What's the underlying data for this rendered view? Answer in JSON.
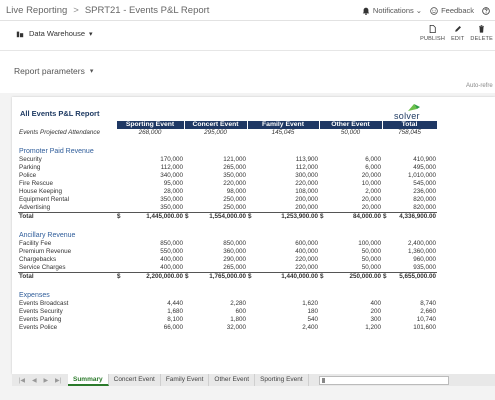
{
  "breadcrumb": {
    "root": "Live Reporting",
    "sep": ">",
    "current": "SPRT21 - Events P&L Report"
  },
  "topbar": {
    "notifications": "Notifications",
    "notif_chev": "⌄",
    "feedback": "Feedback"
  },
  "toolbar": {
    "data_source": "Data Warehouse",
    "chev": "▾",
    "actions": [
      {
        "label": "PUBLISH",
        "icon": "document-icon"
      },
      {
        "label": "EDIT",
        "icon": "pencil-icon"
      },
      {
        "label": "DELETE",
        "icon": "trash-icon"
      }
    ]
  },
  "params": {
    "label": "Report parameters",
    "chev": "▾",
    "auto_refresh": "Auto-refre"
  },
  "report": {
    "title": "All Events P&L Report",
    "logo_text": "solver",
    "columns": [
      "Sporting Event",
      "Concert Event",
      "Family Event",
      "Other Event",
      "Total"
    ],
    "attendance": {
      "label": "Events Projected Attendance",
      "values": [
        "268,000",
        "295,000",
        "145,045",
        "50,000",
        "758,045"
      ]
    },
    "sections": [
      {
        "title": "Promoter Paid Revenue",
        "rows": [
          {
            "label": "Security",
            "values": [
              "170,000",
              "121,000",
              "113,900",
              "6,000",
              "410,900"
            ]
          },
          {
            "label": "Parking",
            "values": [
              "112,000",
              "265,000",
              "112,000",
              "6,000",
              "495,000"
            ]
          },
          {
            "label": "Police",
            "values": [
              "340,000",
              "350,000",
              "300,000",
              "20,000",
              "1,010,000"
            ]
          },
          {
            "label": "Fire Rescue",
            "values": [
              "95,000",
              "220,000",
              "220,000",
              "10,000",
              "545,000"
            ]
          },
          {
            "label": "House Keeping",
            "values": [
              "28,000",
              "98,000",
              "108,000",
              "2,000",
              "236,000"
            ]
          },
          {
            "label": "Equipment Rental",
            "values": [
              "350,000",
              "250,000",
              "200,000",
              "20,000",
              "820,000"
            ]
          },
          {
            "label": "Advertising",
            "values": [
              "350,000",
              "250,000",
              "200,000",
              "20,000",
              "820,000"
            ]
          }
        ],
        "total": {
          "label": "Total",
          "values": [
            "1,445,000.00",
            "1,554,000.00",
            "1,253,900.00",
            "84,000.00",
            "4,336,900.00"
          ]
        }
      },
      {
        "title": "Ancillary Revenue",
        "rows": [
          {
            "label": "Facility Fee",
            "values": [
              "850,000",
              "850,000",
              "600,000",
              "100,000",
              "2,400,000"
            ]
          },
          {
            "label": "Premium Revenue",
            "values": [
              "550,000",
              "360,000",
              "400,000",
              "50,000",
              "1,360,000"
            ]
          },
          {
            "label": "Chargebacks",
            "values": [
              "400,000",
              "290,000",
              "220,000",
              "50,000",
              "960,000"
            ]
          },
          {
            "label": "Service Charges",
            "values": [
              "400,000",
              "265,000",
              "220,000",
              "50,000",
              "935,000"
            ]
          }
        ],
        "total": {
          "label": "Total",
          "values": [
            "2,200,000.00",
            "1,765,000.00",
            "1,440,000.00",
            "250,000.00",
            "5,655,000.00"
          ]
        }
      },
      {
        "title": "Expenses",
        "rows": [
          {
            "label": "Events Broadcast",
            "values": [
              "4,440",
              "2,280",
              "1,620",
              "400",
              "8,740"
            ]
          },
          {
            "label": "Events Security",
            "values": [
              "1,680",
              "600",
              "180",
              "200",
              "2,660"
            ]
          },
          {
            "label": "Events Parking",
            "values": [
              "8,100",
              "1,800",
              "540",
              "300",
              "10,740"
            ]
          },
          {
            "label": "Events Police",
            "values": [
              "66,000",
              "32,000",
              "2,400",
              "1,200",
              "101,600"
            ]
          }
        ]
      }
    ],
    "currency": "$"
  },
  "tabs": {
    "items": [
      "Summary",
      "Concert Event",
      "Family Event",
      "Other Event",
      "Sporting Event"
    ],
    "active": 0,
    "nav": [
      "|◀",
      "◀",
      "▶",
      "▶|"
    ]
  },
  "colors": {
    "header_bg": "#1f3864",
    "section": "#2f5d9a",
    "active_tab": "#2b7a2b"
  }
}
